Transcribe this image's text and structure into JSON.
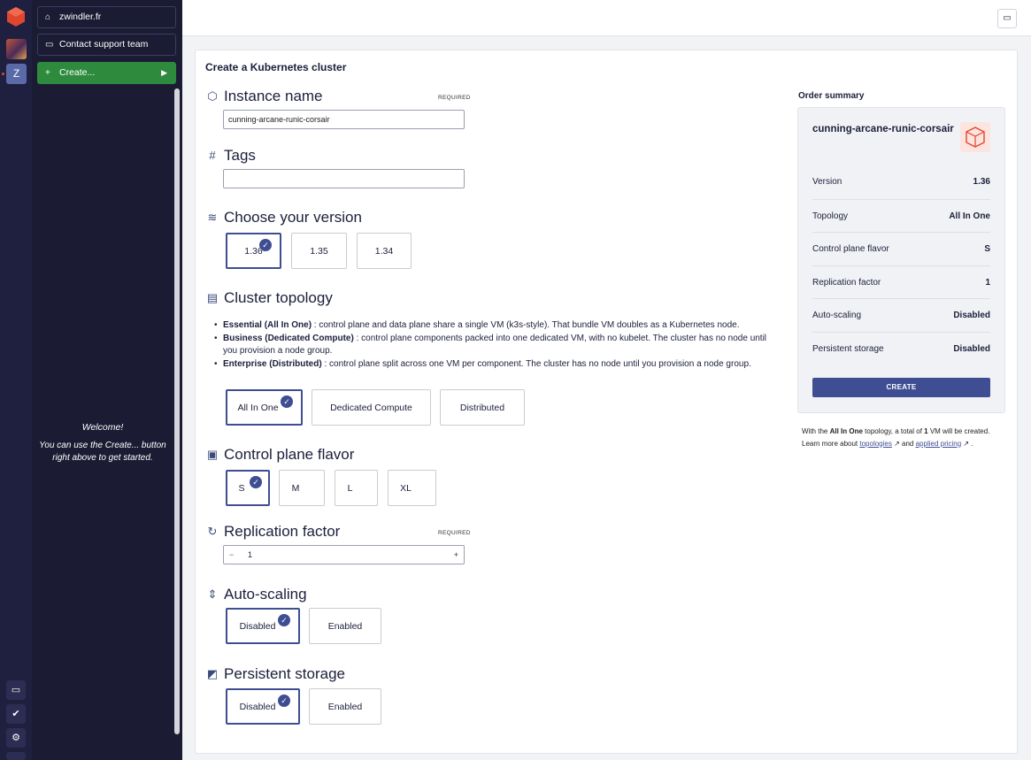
{
  "sidebar": {
    "workspace_label": "zwindler.fr",
    "support_label": "Contact support team",
    "create_label": "Create...",
    "avatar_letter": "Z",
    "welcome_title": "Welcome!",
    "welcome_text": "You can use the Create... button right above to get started."
  },
  "page": {
    "title": "Create a Kubernetes cluster"
  },
  "sections": {
    "instance_name": {
      "label": "Instance name",
      "required": "REQUIRED",
      "value": "cunning-arcane-runic-corsair"
    },
    "tags": {
      "label": "Tags",
      "value": ""
    },
    "version": {
      "label": "Choose your version",
      "options": [
        "1.36",
        "1.35",
        "1.34"
      ],
      "selected": "1.36"
    },
    "topology": {
      "label": "Cluster topology",
      "bullets": [
        {
          "name": "Essential (All In One)",
          "text": " : control plane and data plane share a single VM (k3s-style). That bundle VM doubles as a Kubernetes node."
        },
        {
          "name": "Business (Dedicated Compute)",
          "text": " : control plane components packed into one dedicated VM, with no kubelet. The cluster has no node until you provision a node group."
        },
        {
          "name": "Enterprise (Distributed)",
          "text": " : control plane split across one VM per component. The cluster has no node until you provision a node group."
        }
      ],
      "options": [
        "All In One",
        "Dedicated Compute",
        "Distributed"
      ],
      "selected": "All In One"
    },
    "flavor": {
      "label": "Control plane flavor",
      "options": [
        "S",
        "M",
        "L",
        "XL"
      ],
      "selected": "S"
    },
    "replication": {
      "label": "Replication factor",
      "required": "REQUIRED",
      "minus": "−",
      "value": "1",
      "plus": "+"
    },
    "autoscaling": {
      "label": "Auto-scaling",
      "options": [
        "Disabled",
        "Enabled"
      ],
      "selected": "Disabled"
    },
    "storage": {
      "label": "Persistent storage",
      "options": [
        "Disabled",
        "Enabled"
      ],
      "selected": "Disabled"
    }
  },
  "summary": {
    "title": "Order summary",
    "name": "cunning-arcane-runic-corsair",
    "rows": [
      {
        "label": "Version",
        "value": "1.36"
      },
      {
        "label": "Topology",
        "value": "All In One"
      },
      {
        "label": "Control plane flavor",
        "value": "S"
      },
      {
        "label": "Replication factor",
        "value": "1"
      },
      {
        "label": "Auto-scaling",
        "value": "Disabled"
      },
      {
        "label": "Persistent storage",
        "value": "Disabled"
      }
    ],
    "create_label": "CREATE",
    "note_prefix": "With the ",
    "note_topology": "All In One",
    "note_mid": " topology, a total of ",
    "note_count": "1",
    "note_suffix": " VM will be created.",
    "note_learn": "Learn more about ",
    "note_link1": "topologies",
    "note_and": " and ",
    "note_link2": "applied pricing",
    "note_end": " ."
  },
  "icons": {
    "brand_color": "#e0452d",
    "accent_color": "#3f4e93",
    "create_button_color": "#2e8b3e"
  }
}
